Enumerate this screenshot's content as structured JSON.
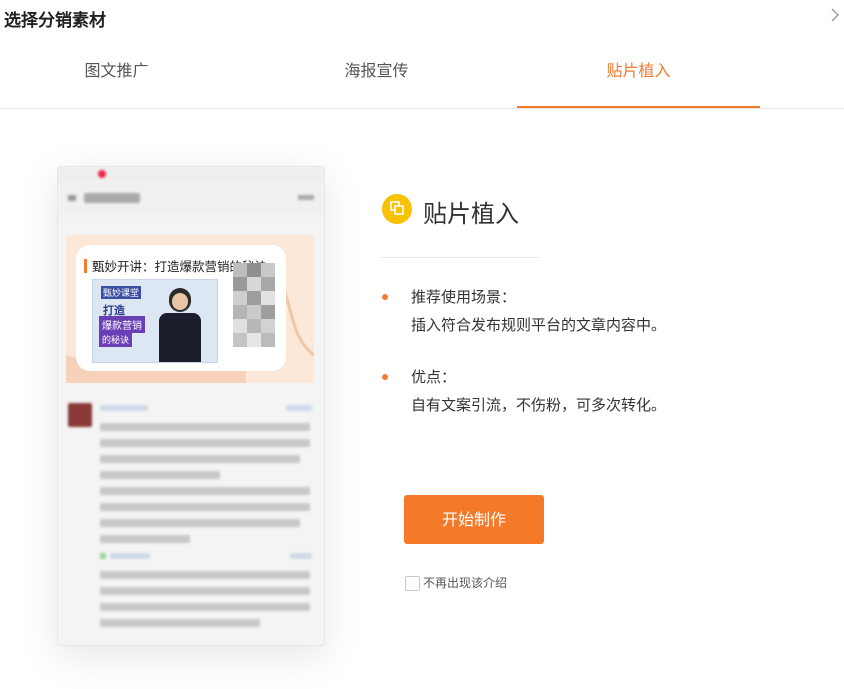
{
  "header": {
    "title": "选择分销素材",
    "close_icon": "chevron-right-icon"
  },
  "tabs": [
    {
      "label": "图文推广",
      "active": false
    },
    {
      "label": "海报宣传",
      "active": false
    },
    {
      "label": "贴片植入",
      "active": true
    }
  ],
  "preview": {
    "ad_title": "甄妙开讲：打造爆款营销的秘诀",
    "thumb_lines": [
      "甄妙课堂",
      "打造",
      "爆款营销",
      "的秘诀"
    ]
  },
  "feature": {
    "icon": "copy-icon",
    "title": "贴片植入",
    "scenario_label": "推荐使用场景：",
    "scenario_text": "插入符合发布规则平台的文章内容中。",
    "advantage_label": "优点：",
    "advantage_text": "自有文案引流，不伤粉，可多次转化。"
  },
  "actions": {
    "start_button": "开始制作",
    "dont_show_label": "不再出现该介绍",
    "dont_show_checked": false
  },
  "colors": {
    "accent": "#f37b2e",
    "icon_bg": "#f8c200"
  }
}
